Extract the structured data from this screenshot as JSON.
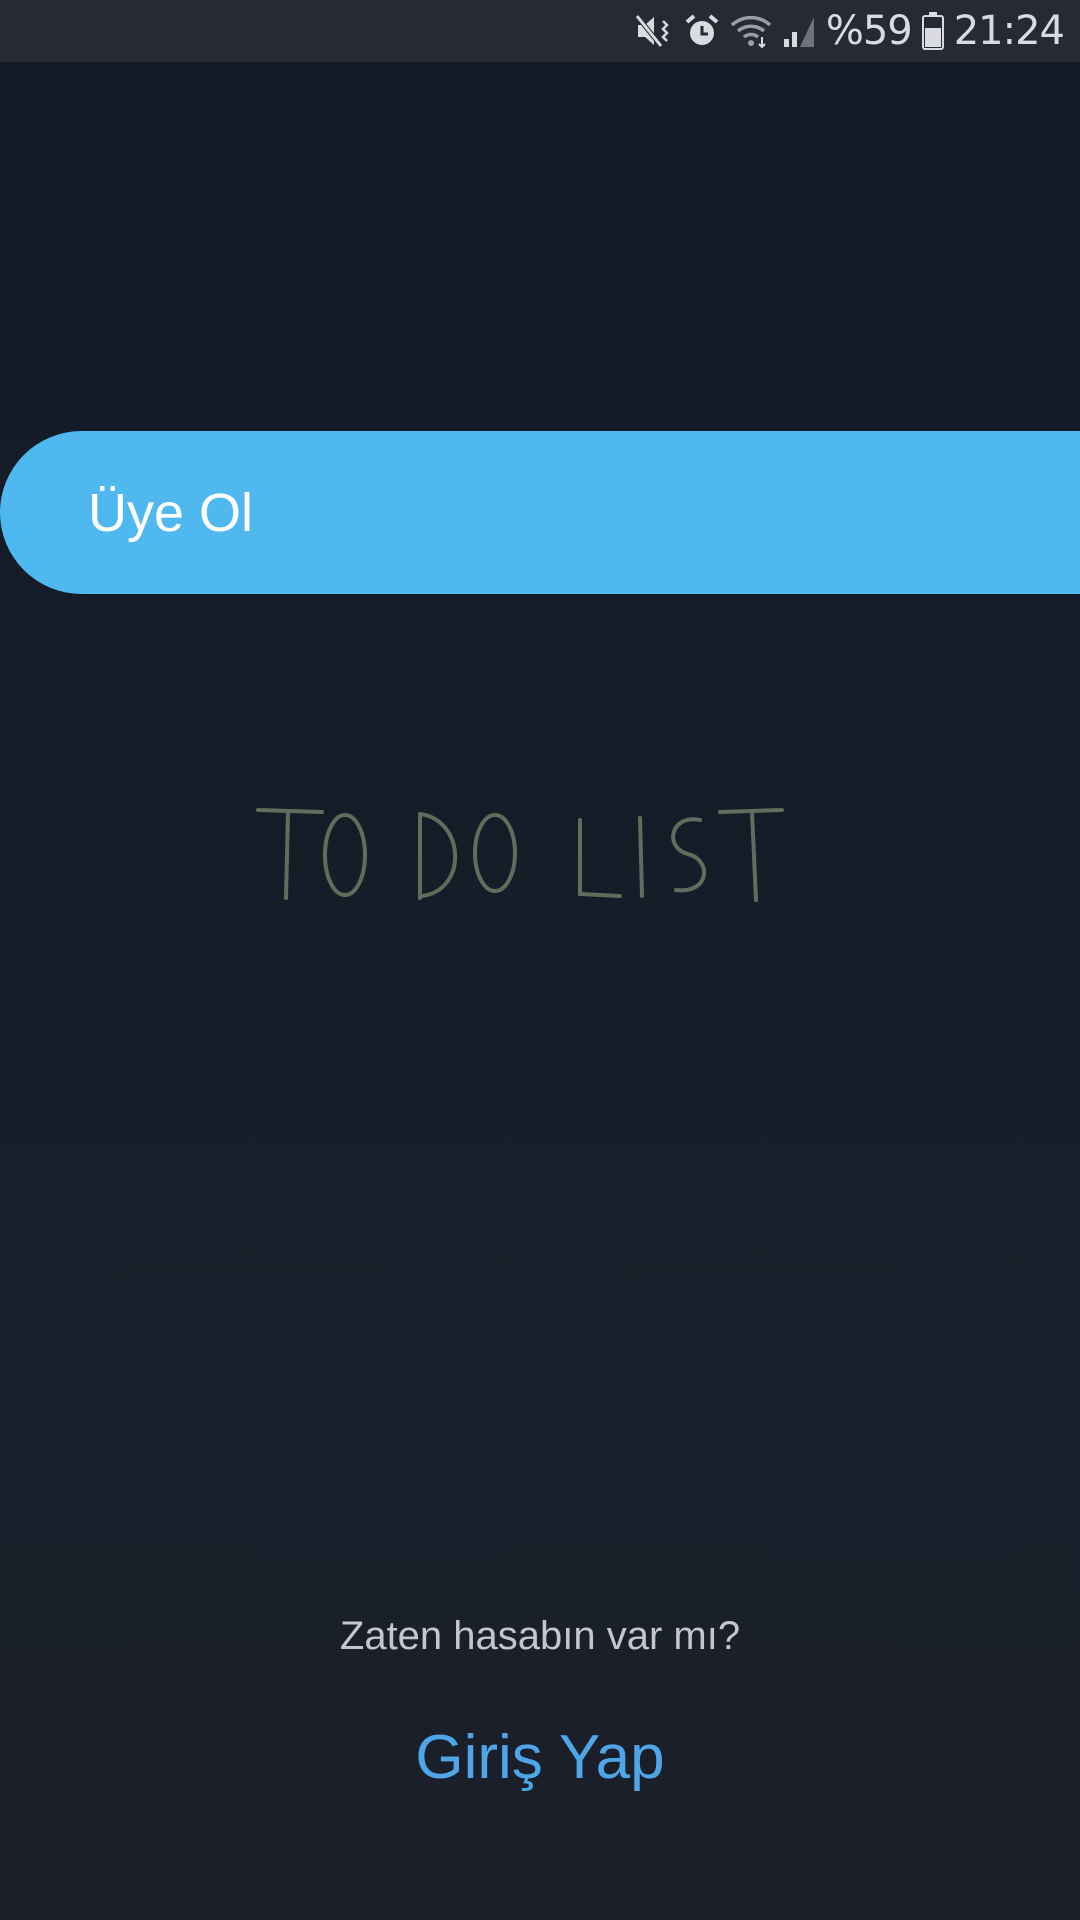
{
  "status_bar": {
    "battery_percent": "%59",
    "time": "21:24",
    "icons": [
      "mute-vibrate-icon",
      "alarm-icon",
      "wifi-icon",
      "signal-icon",
      "battery-icon"
    ]
  },
  "signup": {
    "label": "Üye Ol"
  },
  "logo": {
    "text": "TO DO LIST"
  },
  "login": {
    "prompt": "Zaten hasabın var mı?",
    "link_label": "Giriş Yap"
  },
  "colors": {
    "accent": "#4fb8ef",
    "link": "#4ea6e8",
    "background": "#1b1f2a",
    "status_bar": "#262a33"
  }
}
